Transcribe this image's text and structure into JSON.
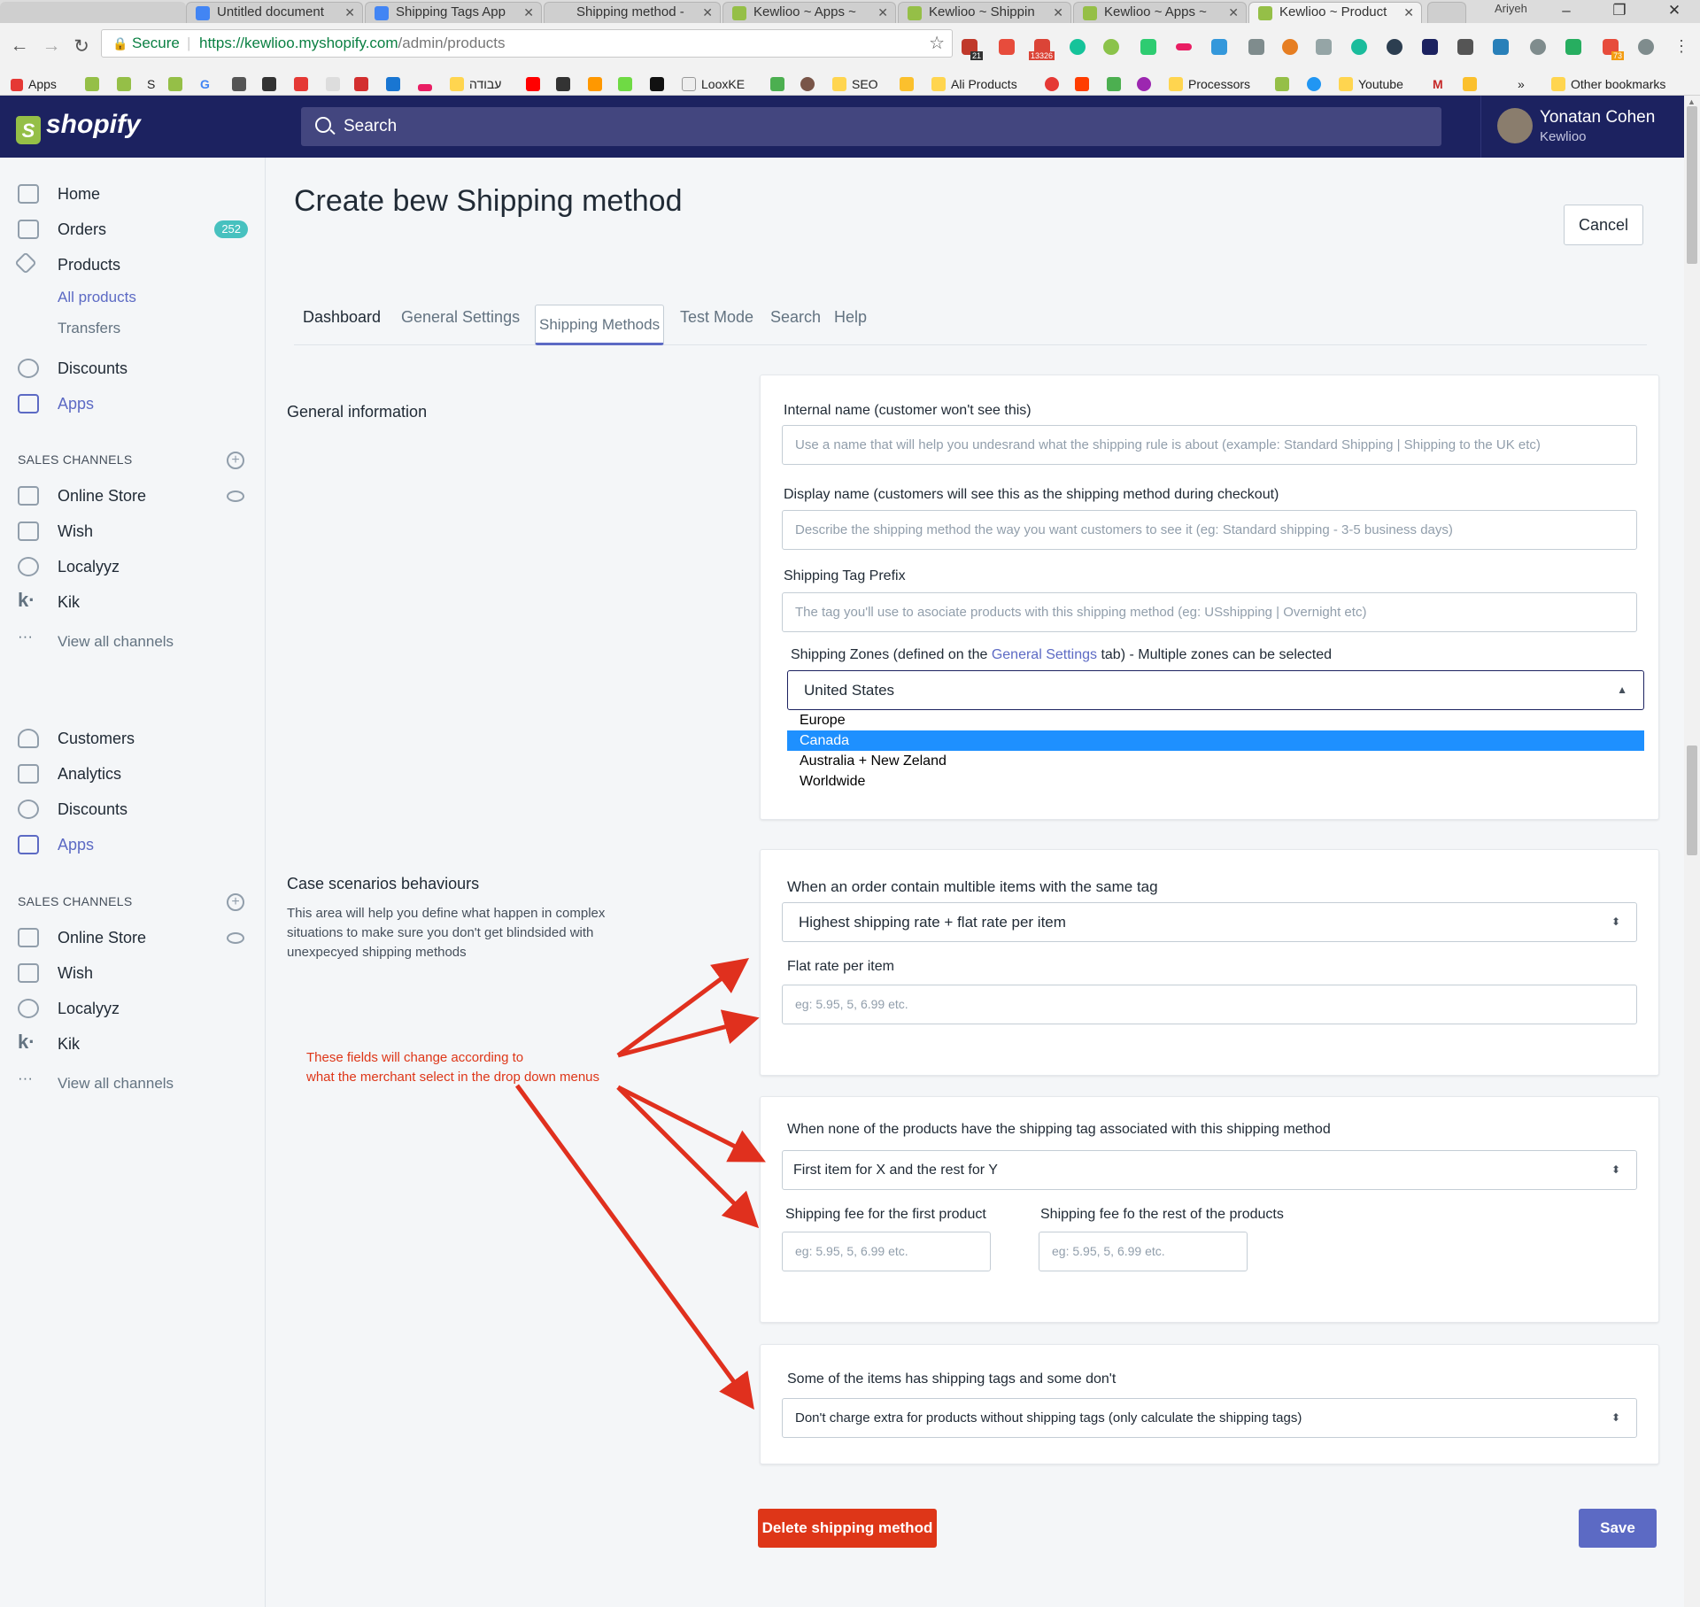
{
  "browser": {
    "tabs": [
      {
        "label": "Untitled document",
        "favicon_color": "#4285f4"
      },
      {
        "label": "Shipping Tags App",
        "favicon_color": "#4285f4"
      },
      {
        "label": "Shipping method -",
        "favicon_color": "#cfcfcf"
      },
      {
        "label": "Kewlioo ~ Apps ~",
        "favicon_color": "#95bf47"
      },
      {
        "label": "Kewlioo ~ Shippin",
        "favicon_color": "#95bf47"
      },
      {
        "label": "Kewlioo ~ Apps ~",
        "favicon_color": "#95bf47"
      },
      {
        "label": "Kewlioo ~ Product",
        "favicon_color": "#95bf47",
        "active": true
      }
    ],
    "window_user": "Ariyeh",
    "secure_label": "Secure",
    "url_host": "https://kewlioo.myshopify.com",
    "url_path": "/admin/products",
    "extension_badges": [
      "21",
      "13326",
      "73"
    ],
    "bookmarks": [
      "Apps",
      "S",
      "G",
      "עבודה",
      "LooxKE",
      "SEO",
      "Ali Products",
      "Processors",
      "Youtube",
      "»",
      "Other bookmarks"
    ]
  },
  "header": {
    "logo_text": "shopify",
    "search_placeholder": "Search",
    "user_name": "Yonatan Cohen",
    "store_name": "Kewlioo"
  },
  "sidebar": {
    "main": [
      {
        "label": "Home",
        "icon": "home-icon"
      },
      {
        "label": "Orders",
        "icon": "orders-icon",
        "badge": "252"
      },
      {
        "label": "Products",
        "icon": "tag-icon"
      },
      {
        "label": "All products",
        "icon": ""
      },
      {
        "label": "Transfers",
        "icon": ""
      },
      {
        "label": "Discounts",
        "icon": "discount-icon"
      },
      {
        "label": "Apps",
        "icon": "apps-icon"
      }
    ],
    "sales_channels_title": "SALES CHANNELS",
    "channels": [
      {
        "label": "Online Store",
        "icon": "store-icon"
      },
      {
        "label": "Wish",
        "icon": "apps-icon"
      },
      {
        "label": "Localyyz",
        "icon": "target-icon"
      },
      {
        "label": "Kik",
        "icon": "kik-icon"
      },
      {
        "label": "View all channels",
        "icon": "dots-icon"
      }
    ],
    "main2": [
      {
        "label": "Customers",
        "icon": "person-icon"
      },
      {
        "label": "Analytics",
        "icon": "chart-icon"
      },
      {
        "label": "Discounts",
        "icon": "discount-icon"
      },
      {
        "label": "Apps",
        "icon": "apps-icon"
      }
    ],
    "channels2": [
      {
        "label": "Online Store",
        "icon": "store-icon"
      },
      {
        "label": "Wish",
        "icon": "apps-icon"
      },
      {
        "label": "Localyyz",
        "icon": "target-icon"
      },
      {
        "label": "Kik",
        "icon": "kik-icon"
      },
      {
        "label": "View all channels",
        "icon": "dots-icon"
      }
    ]
  },
  "page": {
    "title": "Create bew Shipping method",
    "cancel": "Cancel",
    "tabs": [
      "Dashboard",
      "General Settings",
      "Shipping Methods",
      "Test Mode",
      "Search",
      "Help"
    ],
    "general_info_title": "General information",
    "case_title": "Case scenarios behaviours",
    "case_desc": "This area will help you define what happen in complex situations to make sure you don't get blindsided with unexpecyed shipping methods",
    "note": "These fields will change according to\nwhat the merchant select in the drop down menus",
    "delete": "Delete shipping method",
    "save": "Save"
  },
  "general": {
    "internal_label": "Internal name (customer won't see this)",
    "internal_placeholder": "Use a name that will help you undesrand what the shipping rule is about (example: Standard Shipping | Shipping to the UK etc)",
    "display_label": "Display name (customers will see this as the shipping method during checkout)",
    "display_placeholder": "Describe the shipping method the way you want customers to see it (eg: Standard shipping - 3-5 business days)",
    "prefix_label": "Shipping Tag Prefix",
    "prefix_placeholder": "The tag you'll use to asociate products with this shipping method (eg: USshipping | Overnight etc)",
    "zones_label_pre": "Shipping Zones (defined on the ",
    "zones_label_link": "General Settings",
    "zones_label_post": " tab) - Multiple zones can be selected",
    "zones_selected": "United States",
    "zones_options": [
      "Europe",
      "Canada",
      "Australia + New Zeland",
      "Worldwide"
    ],
    "zones_highlighted": "Canada"
  },
  "case1": {
    "label": "When an order contain multible items with the same tag",
    "select": "Highest shipping rate + flat rate per item",
    "flat_label": "Flat rate per item",
    "flat_placeholder": "eg: 5.95, 5, 6.99 etc."
  },
  "case2": {
    "label": "When none of the products have the shipping tag associated with this shipping method",
    "select": "First item for X and the rest for Y",
    "first_label": "Shipping fee for the first product",
    "first_placeholder": "eg: 5.95, 5, 6.99 etc.",
    "rest_label": "Shipping fee fo the rest of the products",
    "rest_placeholder": "eg: 5.95, 5, 6.99 etc."
  },
  "case3": {
    "label": "Some of the items has shipping tags and some don't",
    "select": "Don't charge extra for products without shipping tags (only calculate the shipping tags)"
  },
  "colors": {
    "brand": "#1c2260",
    "accent": "#5c6ac4",
    "danger": "#de3618",
    "arrow": "#e0301e",
    "highlight": "#1e90ff"
  }
}
